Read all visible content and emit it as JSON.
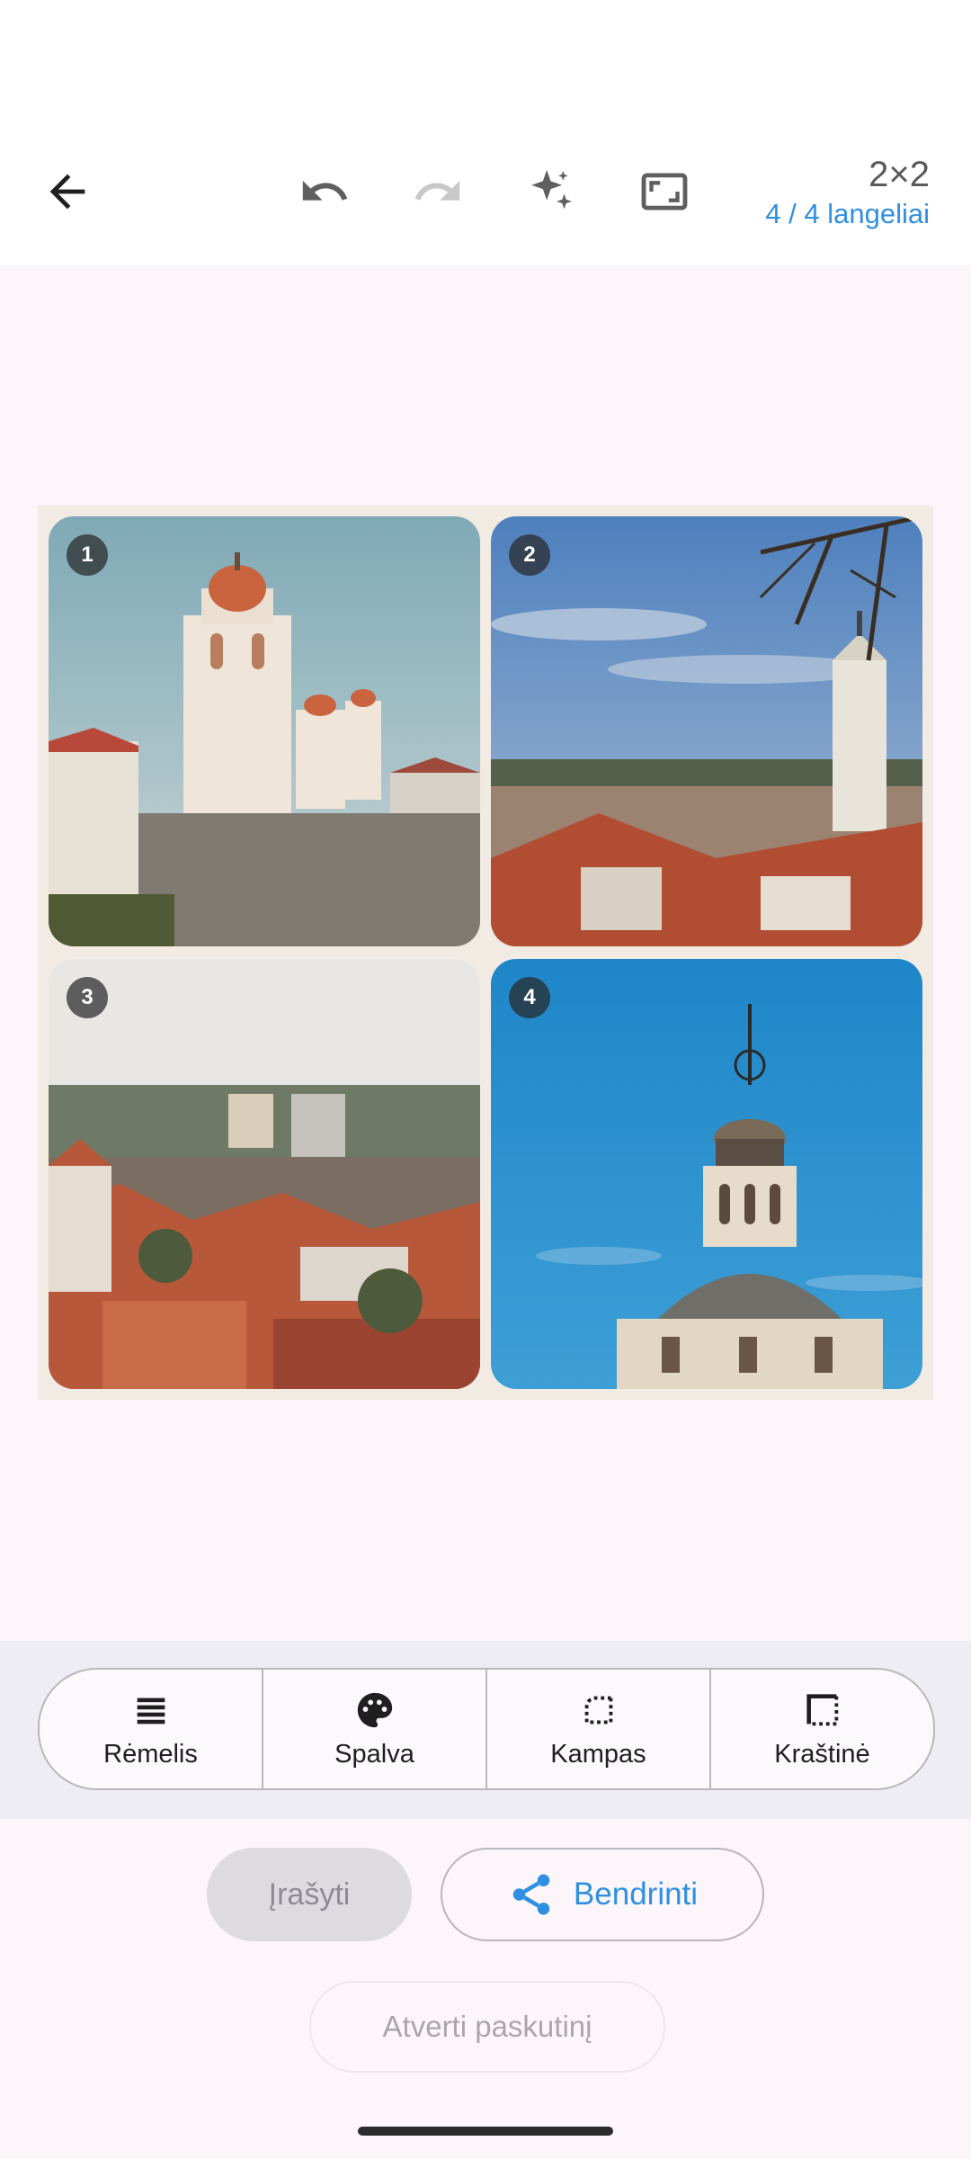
{
  "toolbar": {
    "back_icon": "arrow-left-icon",
    "undo_icon": "undo-icon",
    "redo_icon": "redo-icon",
    "auto_icon": "sparkle-icon",
    "frame_icon": "aspect-ratio-icon",
    "grid_size": "2×2",
    "tiles_count": "4 / 4 langeliai",
    "accent_color": "#2F8FE0"
  },
  "collage": {
    "background": "#F1EBE3",
    "tiles": [
      {
        "number": "1",
        "subject": "church-towers-photo"
      },
      {
        "number": "2",
        "subject": "city-view-tower-photo"
      },
      {
        "number": "3",
        "subject": "old-town-rooftops-photo"
      },
      {
        "number": "4",
        "subject": "baroque-dome-photo"
      }
    ]
  },
  "options": [
    {
      "label": "Rėmelis",
      "icon": "lines-icon"
    },
    {
      "label": "Spalva",
      "icon": "palette-icon"
    },
    {
      "label": "Kampas",
      "icon": "corner-icon"
    },
    {
      "label": "Kraštinė",
      "icon": "border-icon"
    }
  ],
  "actions": {
    "save_label": "Įrašyti",
    "share_label": "Bendrinti",
    "share_icon": "share-icon",
    "open_last_label": "Atverti paskutinį"
  }
}
